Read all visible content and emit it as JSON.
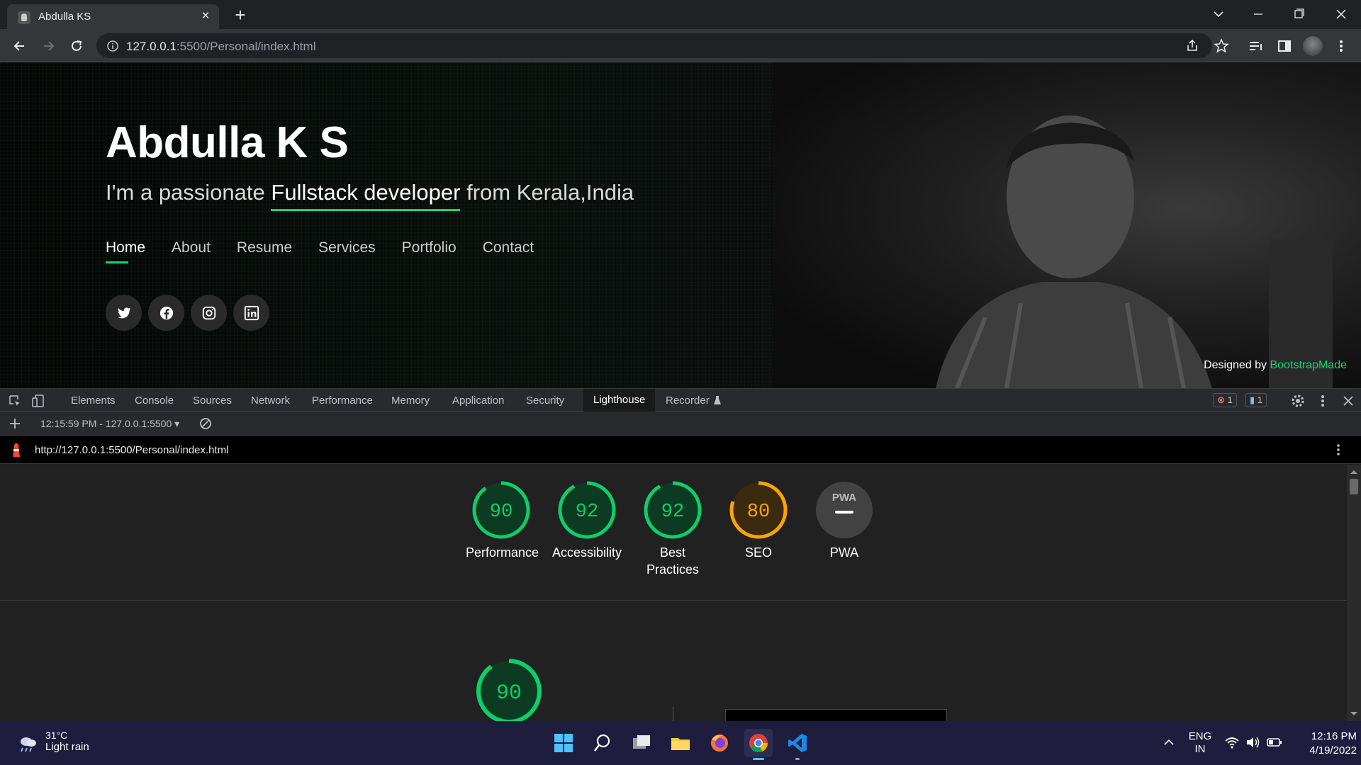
{
  "browser": {
    "tab_title": "Abdulla KS",
    "url_host": "127.0.0.1",
    "url_rest": ":5500/Personal/index.html"
  },
  "hero": {
    "name": "Abdulla K S",
    "tagline_prefix": "I'm a passionate ",
    "tagline_typed": "Fullstack developer",
    "tagline_suffix": " from Kerala,India",
    "nav": [
      "Home",
      "About",
      "Resume",
      "Services",
      "Portfolio",
      "Contact"
    ],
    "active_nav": "Home",
    "socials": [
      "twitter-icon",
      "facebook-icon",
      "instagram-icon",
      "linkedin-icon"
    ],
    "credits_prefix": "Designed by ",
    "credits_link": "BootstrapMade"
  },
  "devtools": {
    "tabs": [
      "Elements",
      "Console",
      "Sources",
      "Network",
      "Performance",
      "Memory",
      "Application",
      "Security",
      "Lighthouse",
      "Recorder"
    ],
    "active_tab": "Lighthouse",
    "error_count": "1",
    "message_count": "1",
    "report_selector": "12:15:59 PM - 127.0.0.1:5500",
    "report_url": "http://127.0.0.1:5500/Personal/index.html",
    "scores": [
      {
        "label": "Performance",
        "score": "90",
        "value": 90,
        "color": "#0cce6b"
      },
      {
        "label": "Accessibility",
        "score": "92",
        "value": 92,
        "color": "#0cce6b"
      },
      {
        "label": "Best Practices",
        "score": "92",
        "value": 92,
        "color": "#0cce6b"
      },
      {
        "label": "SEO",
        "score": "80",
        "value": 80,
        "color": "#ffa400"
      },
      {
        "label": "PWA",
        "score": "",
        "value": 0,
        "color": "#9aa0a6"
      }
    ],
    "pwa_badge": "PWA",
    "main_score": "90"
  },
  "taskbar": {
    "temperature": "31°C",
    "weather": "Light rain",
    "lang": "ENG",
    "region": "IN",
    "time": "12:16 PM",
    "date": "4/19/2022"
  },
  "colors": {
    "accent": "#18d26e",
    "pass": "#0cce6b",
    "average": "#ffa400"
  }
}
